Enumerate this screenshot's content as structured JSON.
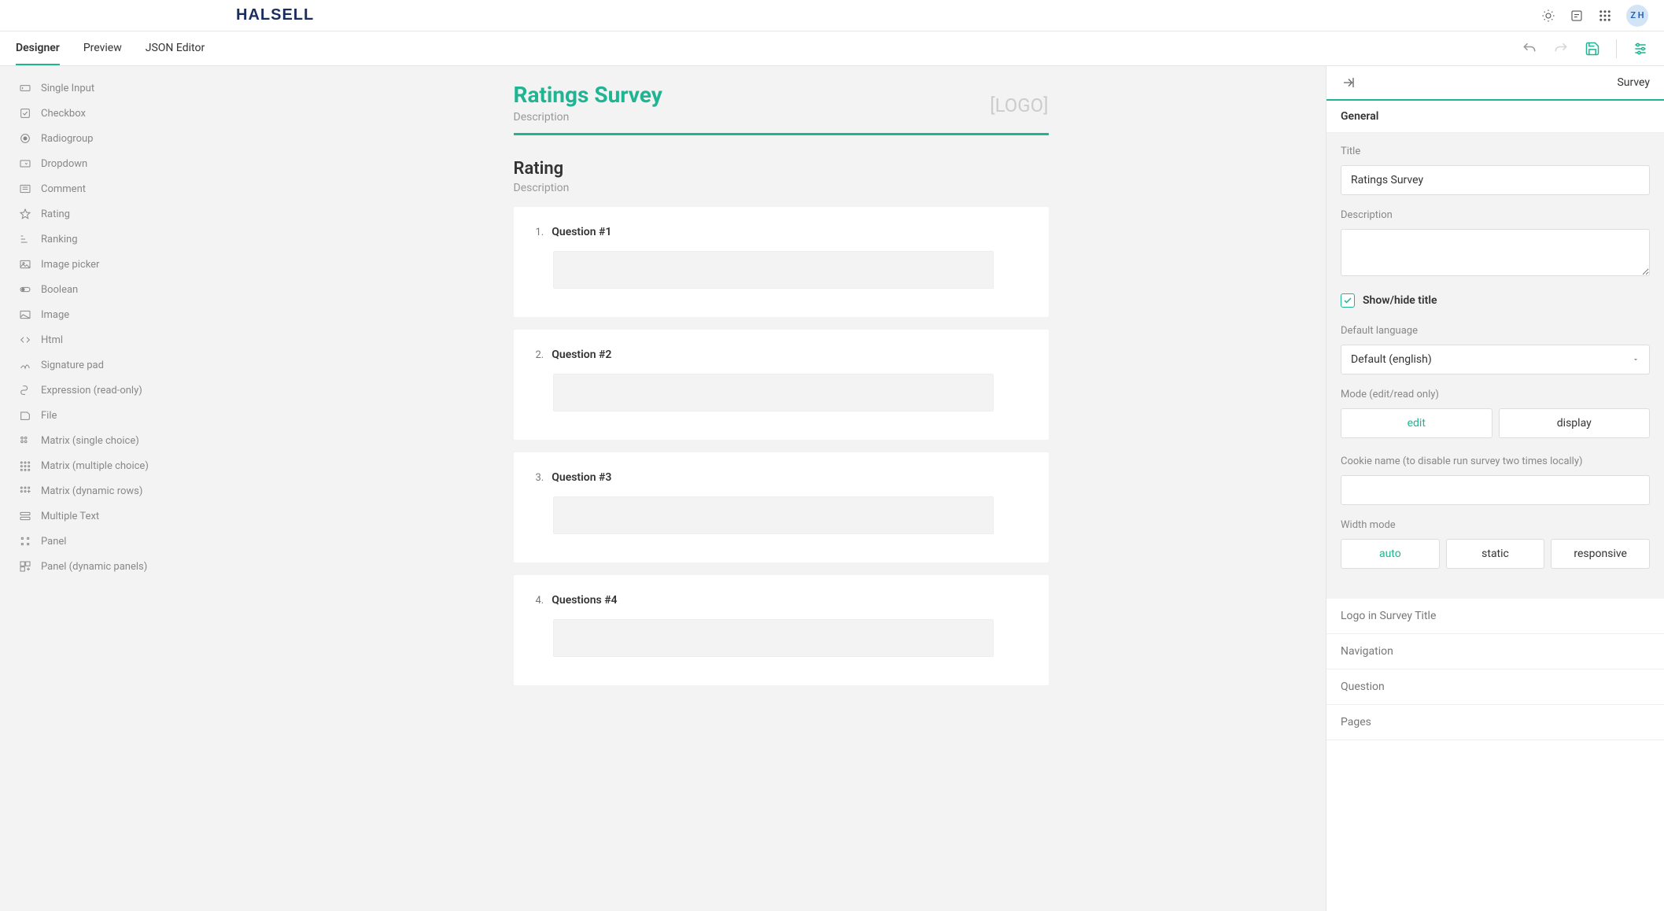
{
  "brand": "HALSELL",
  "avatar": "Z H",
  "tabs": {
    "designer": "Designer",
    "preview": "Preview",
    "json": "JSON Editor"
  },
  "toolbox": [
    {
      "icon": "text-input",
      "label": "Single Input"
    },
    {
      "icon": "checkbox",
      "label": "Checkbox"
    },
    {
      "icon": "radio",
      "label": "Radiogroup"
    },
    {
      "icon": "dropdown",
      "label": "Dropdown"
    },
    {
      "icon": "comment",
      "label": "Comment"
    },
    {
      "icon": "star",
      "label": "Rating"
    },
    {
      "icon": "ranking",
      "label": "Ranking"
    },
    {
      "icon": "image-picker",
      "label": "Image picker"
    },
    {
      "icon": "toggle",
      "label": "Boolean"
    },
    {
      "icon": "image",
      "label": "Image"
    },
    {
      "icon": "html",
      "label": "Html"
    },
    {
      "icon": "signature",
      "label": "Signature pad"
    },
    {
      "icon": "function",
      "label": "Expression (read-only)"
    },
    {
      "icon": "file",
      "label": "File"
    },
    {
      "icon": "matrix-single",
      "label": "Matrix (single choice)"
    },
    {
      "icon": "matrix-multi",
      "label": "Matrix (multiple choice)"
    },
    {
      "icon": "matrix-dyn",
      "label": "Matrix (dynamic rows)"
    },
    {
      "icon": "multitext",
      "label": "Multiple Text"
    },
    {
      "icon": "panel",
      "label": "Panel"
    },
    {
      "icon": "panel-dyn",
      "label": "Panel (dynamic panels)"
    }
  ],
  "survey": {
    "title": "Ratings Survey",
    "description": "Description",
    "logoPlaceholder": "[LOGO]",
    "section": {
      "title": "Rating",
      "description": "Description"
    },
    "questions": [
      {
        "num": "1.",
        "text": "Question #1"
      },
      {
        "num": "2.",
        "text": "Question #2"
      },
      {
        "num": "3.",
        "text": "Question #3"
      },
      {
        "num": "4.",
        "text": "Questions #4"
      }
    ]
  },
  "rightPanel": {
    "header": "Survey",
    "section": "General",
    "titleLabel": "Title",
    "titleValue": "Ratings Survey",
    "descLabel": "Description",
    "descValue": "",
    "showHide": "Show/hide title",
    "langLabel": "Default language",
    "langValue": "Default (english)",
    "modeLabel": "Mode (edit/read only)",
    "modeEdit": "edit",
    "modeDisplay": "display",
    "cookieLabel": "Cookie name (to disable run survey two times locally)",
    "cookieValue": "",
    "widthLabel": "Width mode",
    "widthAuto": "auto",
    "widthStatic": "static",
    "widthResp": "responsive",
    "accordion": [
      "Logo in Survey Title",
      "Navigation",
      "Question",
      "Pages"
    ]
  }
}
